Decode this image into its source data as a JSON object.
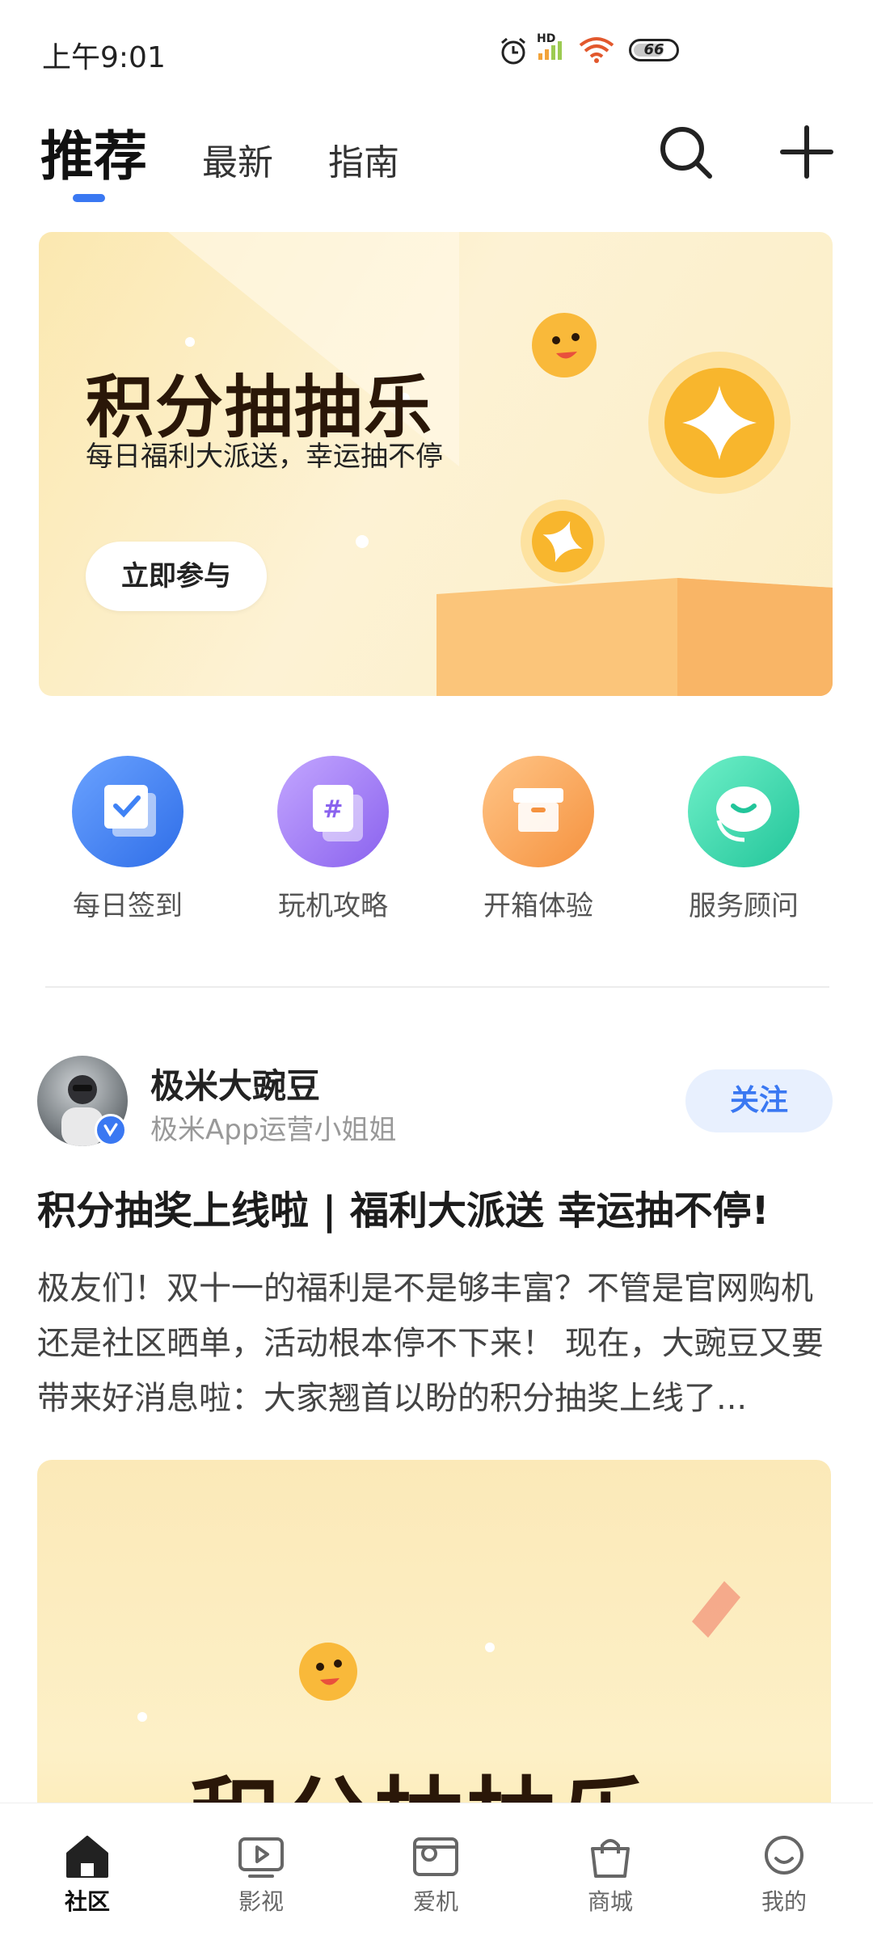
{
  "status_bar": {
    "time": "上午9:01",
    "battery": "66",
    "network": "HD"
  },
  "header": {
    "tabs": [
      "推荐",
      "最新",
      "指南"
    ],
    "active_tab": "推荐"
  },
  "banner": {
    "title": "积分抽抽乐",
    "subtitle": "每日福利大派送，幸运抽不停",
    "button": "立即参与"
  },
  "quick_entries": [
    {
      "label": "每日签到",
      "icon": "checkin-icon",
      "color": "#3f82f5"
    },
    {
      "label": "玩机攻略",
      "icon": "hashtag-icon",
      "color": "#a07cf3"
    },
    {
      "label": "开箱体验",
      "icon": "gift-box-icon",
      "color": "#f9a555"
    },
    {
      "label": "服务顾问",
      "icon": "support-icon",
      "color": "#3fd6ab"
    }
  ],
  "post": {
    "author": "极米大豌豆",
    "role": "极米App运营小姐姐",
    "follow": "关注",
    "title": "积分抽奖上线啦 | 福利大派送  幸运抽不停!",
    "body": "极友们！双十一的福利是不是够丰富？不管是官网购机还是社区晒单，活动根本停不下来！ 现在，大豌豆又要带来好消息啦：大家翘首以盼的积分抽奖上线了...",
    "image_title": "积分抽抽乐"
  },
  "bottom_nav": [
    {
      "label": "社区",
      "icon": "home-icon"
    },
    {
      "label": "影视",
      "icon": "play-icon"
    },
    {
      "label": "爱机",
      "icon": "projector-icon"
    },
    {
      "label": "商城",
      "icon": "shopping-bag-icon"
    },
    {
      "label": "我的",
      "icon": "profile-icon"
    }
  ],
  "bottom_nav_active": "社区",
  "colors": {
    "accent": "#3a78f2",
    "banner_bg": "#fbe8b0",
    "follow_bg": "#e8f0fe"
  }
}
